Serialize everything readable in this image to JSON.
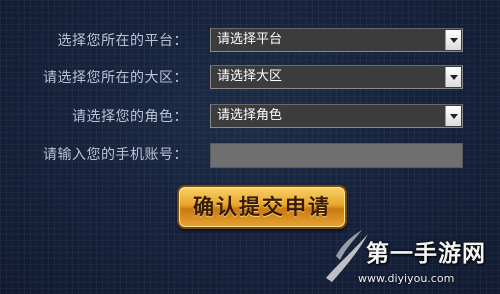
{
  "form": {
    "platform": {
      "label": "选择您所在的平台：",
      "value": "请选择平台"
    },
    "region": {
      "label": "请选择您所在的大区：",
      "value": "请选择大区"
    },
    "role": {
      "label": "请选择您的角色：",
      "value": "请选择角色"
    },
    "phone": {
      "label": "请输入您的手机账号：",
      "value": ""
    },
    "submit_label": "确认提交申请"
  },
  "watermark": {
    "title": "第一手游网",
    "url": "www.diyiyou.com"
  },
  "colors": {
    "background": "#17233a",
    "label_text": "#b9c2d2",
    "select_bg": "#3c3c3c",
    "input_bg": "#6f6f6f",
    "button_gold": "#e9a52a",
    "button_text": "#3a1a05"
  },
  "icons": {
    "dropdown": "chevron-down-icon",
    "watermark_logo": "swoosh-logo-icon"
  }
}
